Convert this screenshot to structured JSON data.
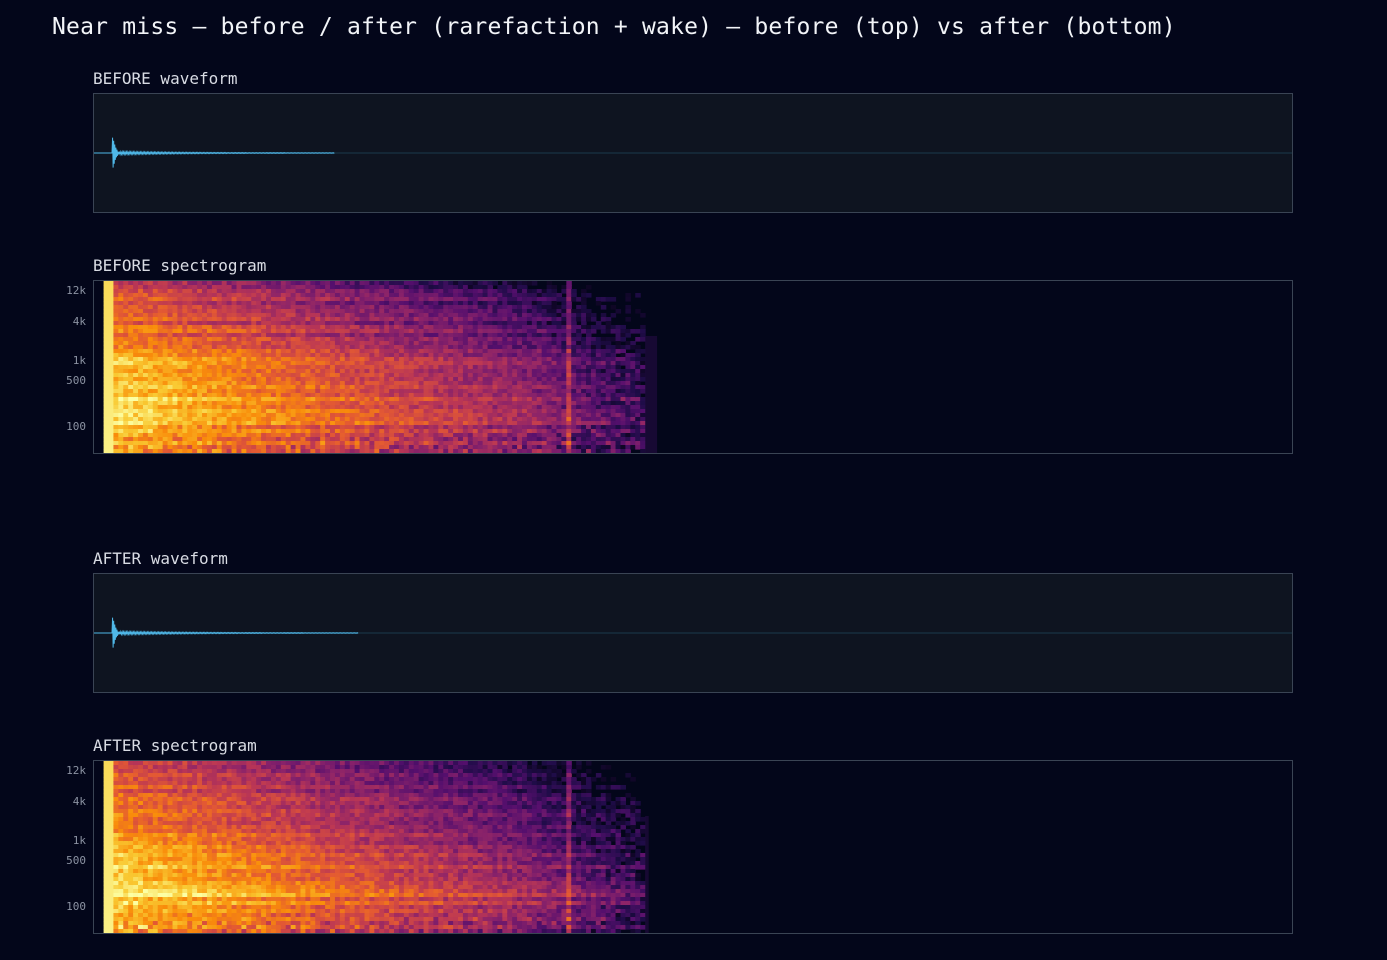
{
  "title": "Near miss — before / after (rarefaction + wake) — before (top) vs after (bottom)",
  "colors": {
    "background": "#03061a",
    "waveform_panel": "#0e1420",
    "panel_border": "#3a4454",
    "waveform_line": "#4fb8e8",
    "colormap": "inferno"
  },
  "chart_data": [
    {
      "type": "line",
      "title": "BEFORE waveform",
      "series": [
        {
          "onset": 0.015,
          "burst_amplitude": 0.13,
          "decay_end": 0.2,
          "line_end": 0.2
        }
      ]
    },
    {
      "type": "heatmap",
      "title": "BEFORE spectrogram",
      "y_ticks": [
        "12k",
        "4k",
        "1k",
        "500",
        "100"
      ],
      "y_scale": "log",
      "onset": 0.008,
      "energy_end": 0.46,
      "tail_end": 0.47,
      "transient_at": 0.395
    },
    {
      "type": "line",
      "title": "AFTER waveform",
      "series": [
        {
          "onset": 0.015,
          "burst_amplitude": 0.13,
          "decay_end": 0.22,
          "line_end": 0.22
        }
      ]
    },
    {
      "type": "heatmap",
      "title": "AFTER spectrogram",
      "y_ticks": [
        "12k",
        "4k",
        "1k",
        "500",
        "100"
      ],
      "y_scale": "log",
      "onset": 0.008,
      "energy_end": 0.46,
      "tail_end": 0.463,
      "transient_at": 0.395
    }
  ]
}
